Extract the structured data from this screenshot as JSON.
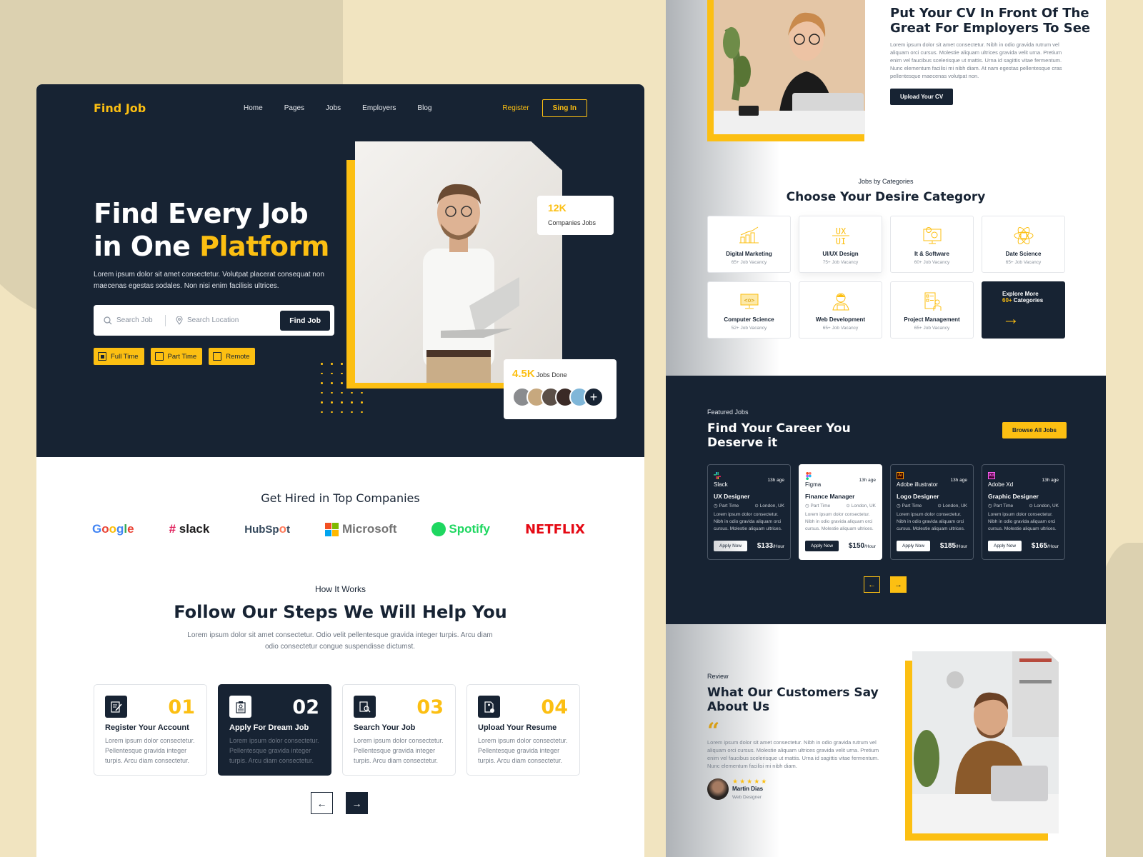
{
  "colors": {
    "accent": "#fcbf12",
    "dark": "#172333",
    "background": "#f1e4c0"
  },
  "nav": {
    "logo": "Find Job",
    "links": [
      "Home",
      "Pages",
      "Jobs",
      "Employers",
      "Blog"
    ],
    "register": "Register",
    "signin": "Sing In"
  },
  "hero": {
    "title_line1": "Find Every Job",
    "title_line2_plain": "in One ",
    "title_line2_accent": "Platform",
    "description": "Lorem ipsum dolor sit amet consectetur. Volutpat placerat consequat non maecenas egestas sodales. Non nisi enim facilisis ultrices.",
    "search_job_placeholder": "Search Job",
    "search_location_placeholder": "Search Location",
    "find_button": "Find Job",
    "filters": [
      {
        "label": "Full Time",
        "checked": true
      },
      {
        "label": "Part Time",
        "checked": false
      },
      {
        "label": "Remote",
        "checked": false
      }
    ],
    "stat_companies": {
      "value": "12K",
      "label": "Companies Jobs"
    },
    "stat_jobs": {
      "value": "4.5K",
      "label": "Jobs Done"
    }
  },
  "companies": {
    "title": "Get Hired in Top Companies",
    "logos": [
      "Google",
      "slack",
      "HubSpot",
      "Microsoft",
      "Spotify",
      "NETFLIX"
    ]
  },
  "how": {
    "subtitle": "How It Works",
    "title": "Follow Our Steps We Will Help You",
    "description": "Lorem ipsum dolor sit amet consectetur. Odio velit pellentesque gravida integer turpis. Arcu diam odio consectetur congue suspendisse dictumst.",
    "steps": [
      {
        "num": "01",
        "title": "Register Your Account",
        "desc": "Lorem ipsum dolor consectetur. Pellentesque gravida integer turpis. Arcu diam consectetur.",
        "icon": "edit-document-icon"
      },
      {
        "num": "02",
        "title": "Apply For Dream Job",
        "desc": "Lorem ipsum dolor consectetur. Pellentesque gravida integer turpis. Arcu diam consectetur.",
        "icon": "clipboard-icon"
      },
      {
        "num": "03",
        "title": "Search Your Job",
        "desc": "Lorem ipsum dolor consectetur. Pellentesque gravida integer turpis. Arcu diam consectetur.",
        "icon": "search-document-icon"
      },
      {
        "num": "04",
        "title": "Upload Your Resume",
        "desc": "Lorem ipsum dolor consectetur. Pellentesque gravida integer turpis. Arcu diam consectetur.",
        "icon": "upload-resume-icon"
      }
    ],
    "prev": "←",
    "next": "→"
  },
  "cv": {
    "title_line1": "Put Your CV In Front Of The",
    "title_line2": "Great For Employers To See",
    "description": "Lorem ipsum dolor sit amet consectetur. Nibh in odio gravida rutrum vel aliquam orci cursus. Molestie aliquam ultrices gravida velit urna. Pretium enim vel faucibus scelerisque ut mattis. Urna id sagittis vitae fermentum. Nunc elementum facilisi mi nibh diam. At nam egestas pellentesque cras pellentesque maecenas volutpat non.",
    "button": "Upload Your CV"
  },
  "categories": {
    "subtitle": "Jobs by Categories",
    "title": "Choose Your Desire Category",
    "items": [
      {
        "name": "Digital Marketing",
        "count": "65+ Job Vacancy",
        "icon": "chart-icon"
      },
      {
        "name": "UI/UX Design",
        "count": "75+ Job Vacancy",
        "icon": "ux-ui-icon"
      },
      {
        "name": "It & Software",
        "count": "60+ Job Vacancy",
        "icon": "monitor-gear-icon"
      },
      {
        "name": "Date Science",
        "count": "65+ Job Vacancy",
        "icon": "atom-icon"
      },
      {
        "name": "Computer Science",
        "count": "52+ Job Vacancy",
        "icon": "code-monitor-icon"
      },
      {
        "name": "Web Development",
        "count": "65+ Job Vacancy",
        "icon": "developer-icon"
      },
      {
        "name": "Project Management",
        "count": "65+ Job Vacancy",
        "icon": "checklist-person-icon"
      }
    ],
    "explore_line1": "Explore More",
    "explore_count": "60+",
    "explore_line2": " Categories",
    "explore_arrow": "→"
  },
  "featured": {
    "subtitle": "Featured Jobs",
    "title": "Find Your Career You Deserve it",
    "browse": "Browse All Jobs",
    "jobs": [
      {
        "company": "Slack",
        "age": "13h age",
        "title": "UX Designer",
        "type": "Part Time",
        "location": "London, UK",
        "desc": "Lorem ipsum dolor consectetur. Nibh in odio gravida aliquam orci cursus. Molestie aliquam ultrices.",
        "apply": "Apply Now",
        "price": "$133",
        "unit": "/Hour"
      },
      {
        "company": "Figma",
        "age": "13h age",
        "title": "Finance Manager",
        "type": "Part Time",
        "location": "London, UK",
        "desc": "Lorem ipsum dolor consectetur. Nibh in odio gravida aliquam orci cursus. Molestie aliquam ultrices.",
        "apply": "Apply Now",
        "price": "$150",
        "unit": "/Hour"
      },
      {
        "company": "Adobe illustrator",
        "age": "13h age",
        "title": "Logo Designer",
        "type": "Part Time",
        "location": "London, UK",
        "desc": "Lorem ipsum dolor consectetur. Nibh in odio gravida aliquam orci cursus. Molestie aliquam ultrices.",
        "apply": "Apply Now",
        "price": "$185",
        "unit": "/Hour"
      },
      {
        "company": "Adobe Xd",
        "age": "13h age",
        "title": "Graphic Designer",
        "type": "Part Time",
        "location": "London, UK",
        "desc": "Lorem ipsum dolor consectetur. Nibh in odio gravida aliquam orci cursus. Molestie aliquam ultrices.",
        "apply": "Apply Now",
        "price": "$165",
        "unit": "/Hour"
      }
    ],
    "prev": "←",
    "next": "→"
  },
  "review": {
    "subtitle": "Review",
    "title_line1": "What Our Customers Say",
    "title_line2": "About Us",
    "quote_mark": "“",
    "text": "Lorem ipsum dolor sit amet consectetur. Nibh in odio gravida rutrum vel aliquam orci cursus. Molestie aliquam ultrices gravida velit urna. Pretium enim vel faucibus scelerisque ut mattis. Urna id sagittis vitae fermentum. Nunc elementum facilisi mi nibh diam.",
    "stars": "★★★★★",
    "rating": 5,
    "name": "Martin Dias",
    "role": "Web Designer"
  }
}
